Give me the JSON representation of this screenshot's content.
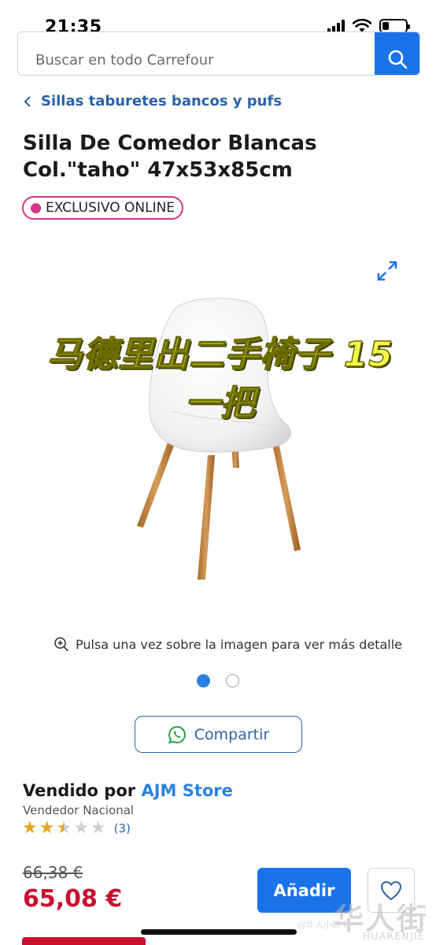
{
  "status_bar": {
    "time": "21:35"
  },
  "search": {
    "placeholder": "Buscar en todo Carrefour"
  },
  "breadcrumb": {
    "label": "Sillas taburetes bancos y pufs"
  },
  "product": {
    "title": "Silla De Comedor Blancas Col.\"taho\" 47x53x85cm",
    "badge": "EXCLUSIVO ONLINE",
    "overlay_text": "马德里出二手椅子 15一把",
    "image_hint": "Pulsa una vez sobre la imagen para ver más detalle",
    "image_count": 2,
    "active_image": 1
  },
  "share": {
    "label": "Compartir"
  },
  "seller": {
    "prefix": "Vendido por",
    "name": "AJM Store",
    "type": "Vendedor Nacional",
    "rating": 2.5,
    "rating_max": 5,
    "rating_count": "(3)"
  },
  "pricing": {
    "old_price": "66,38 €",
    "price": "65,08 €",
    "add_label": "Añadir"
  },
  "watermark": {
    "main": "华人街",
    "sub": "HUARENJIE",
    "small": "@华人小红书"
  },
  "colors": {
    "brand_blue": "#1a73e8",
    "link_blue": "#2b62a8",
    "price_red": "#c8102e",
    "badge_pink": "#d6368a",
    "star_gold": "#e8a317"
  },
  "icons": [
    "search-icon",
    "chevron-left-icon",
    "expand-icon",
    "zoom-in-icon",
    "whatsapp-icon",
    "heart-icon",
    "signal-icon",
    "wifi-icon",
    "battery-icon"
  ]
}
